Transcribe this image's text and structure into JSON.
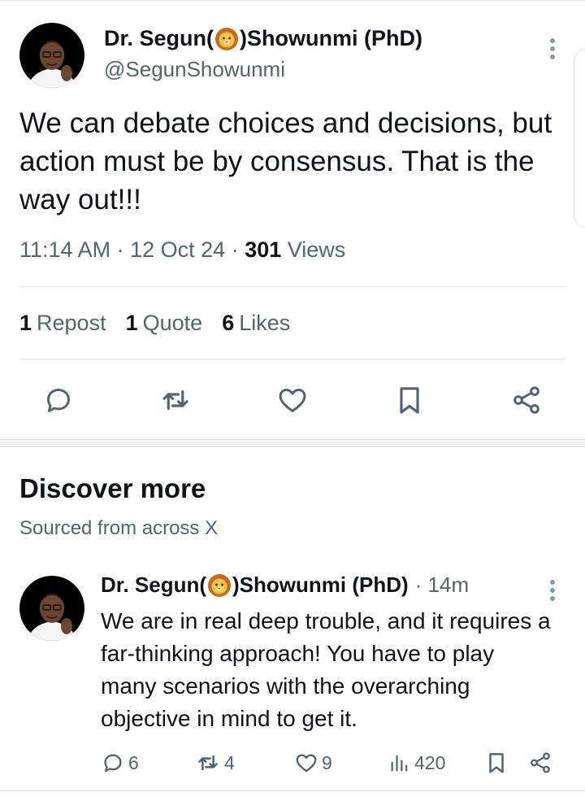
{
  "tweet": {
    "author": {
      "name_prefix": "Dr. Segun(",
      "name_suffix": ")Showunmi (PhD)",
      "handle": "@SegunShowunmi",
      "avatar": "author-photo",
      "emoji": "lion-face"
    },
    "text": "We can debate choices and decisions, but action must be by consensus. That is the way out!!!",
    "time": "11:14 AM",
    "date": "12 Oct 24",
    "views_count": "301",
    "views_label": "Views",
    "reposts_count": "1",
    "reposts_label": "Repost",
    "quotes_count": "1",
    "quotes_label": "Quote",
    "likes_count": "6",
    "likes_label": "Likes",
    "actions": [
      "reply-icon",
      "retweet-icon",
      "heart-icon",
      "bookmark-icon",
      "share-icon"
    ]
  },
  "discover": {
    "title": "Discover more",
    "subtitle": "Sourced from across X"
  },
  "related_post": {
    "author": {
      "name_prefix": "Dr. Segun(",
      "name_suffix": ")Showunmi (PhD)",
      "avatar": "author-photo",
      "emoji": "lion-face"
    },
    "time": "· 14m",
    "text": "We are in real deep trouble, and it requires a far-thinking approach! You have to play many scenarios with the overarching objective in mind to get it.",
    "replies": "6",
    "reposts": "4",
    "likes": "9",
    "views": "420"
  },
  "colors": {
    "text_primary": "#0f1419",
    "text_secondary": "#536471",
    "divider": "#e1e4e7"
  }
}
